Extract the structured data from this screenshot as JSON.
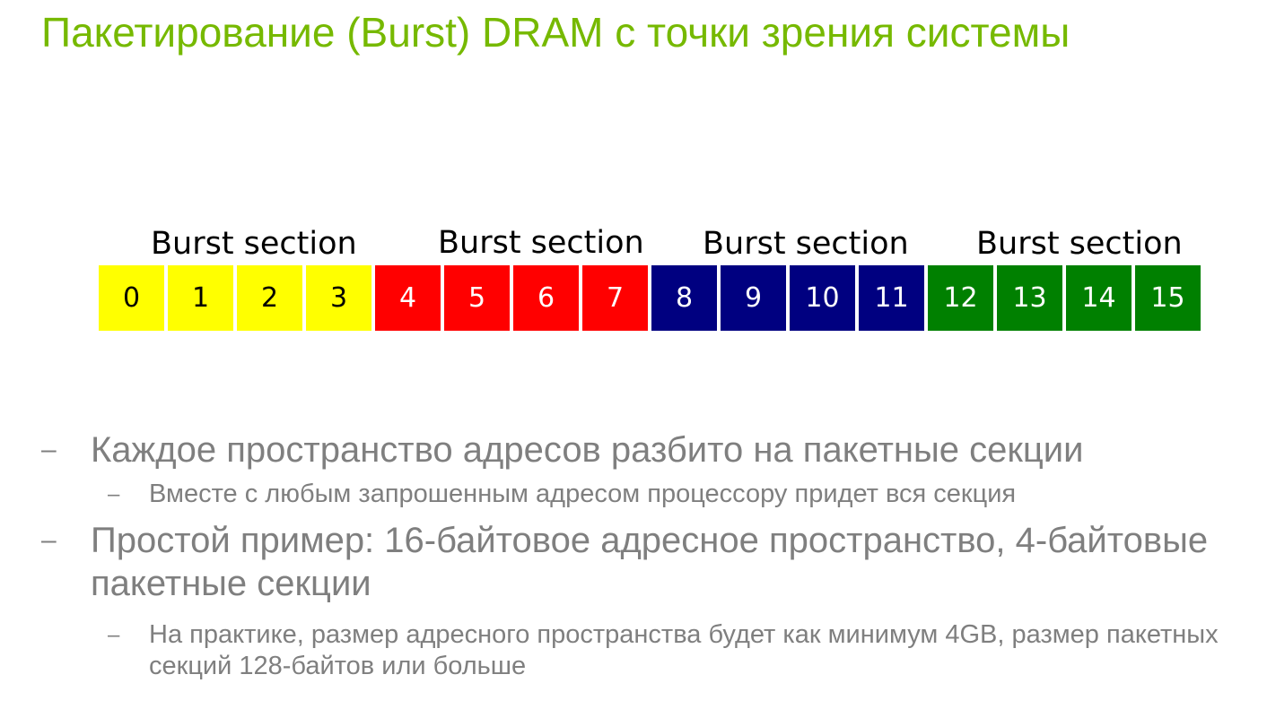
{
  "title": "Пакетирование (Burst) DRAM с точки зрения системы",
  "diagram": {
    "sections": [
      {
        "label": "Burst section",
        "color": "#ffff00",
        "text_color": "#000000",
        "cells": [
          "0",
          "1",
          "2",
          "3"
        ]
      },
      {
        "label": "Burst section",
        "color": "#ff0000",
        "text_color": "#ffffff",
        "cells": [
          "4",
          "5",
          "6",
          "7"
        ]
      },
      {
        "label": "Burst section",
        "color": "#000080",
        "text_color": "#ffffff",
        "cells": [
          "8",
          "9",
          "10",
          "11"
        ]
      },
      {
        "label": "Burst section",
        "color": "#008000",
        "text_color": "#ffffff",
        "cells": [
          "12",
          "13",
          "14",
          "15"
        ]
      }
    ]
  },
  "bullets": {
    "dash": "–",
    "item1": "Каждое пространство адресов разбито на пакетные секции",
    "item1_sub": "Вместе с любым запрошенным адресом процессору придет вся секция",
    "item2": "Простой пример: 16-байтовое адресное пространство, 4-байтовые пакетные секции",
    "item2_sub": "На практике, размер адресного пространства будет как минимум 4GB, размер пакетных секций 128-байтов или больше"
  },
  "colors": {
    "title": "#76b900",
    "body_text": "#7f7f7f"
  }
}
